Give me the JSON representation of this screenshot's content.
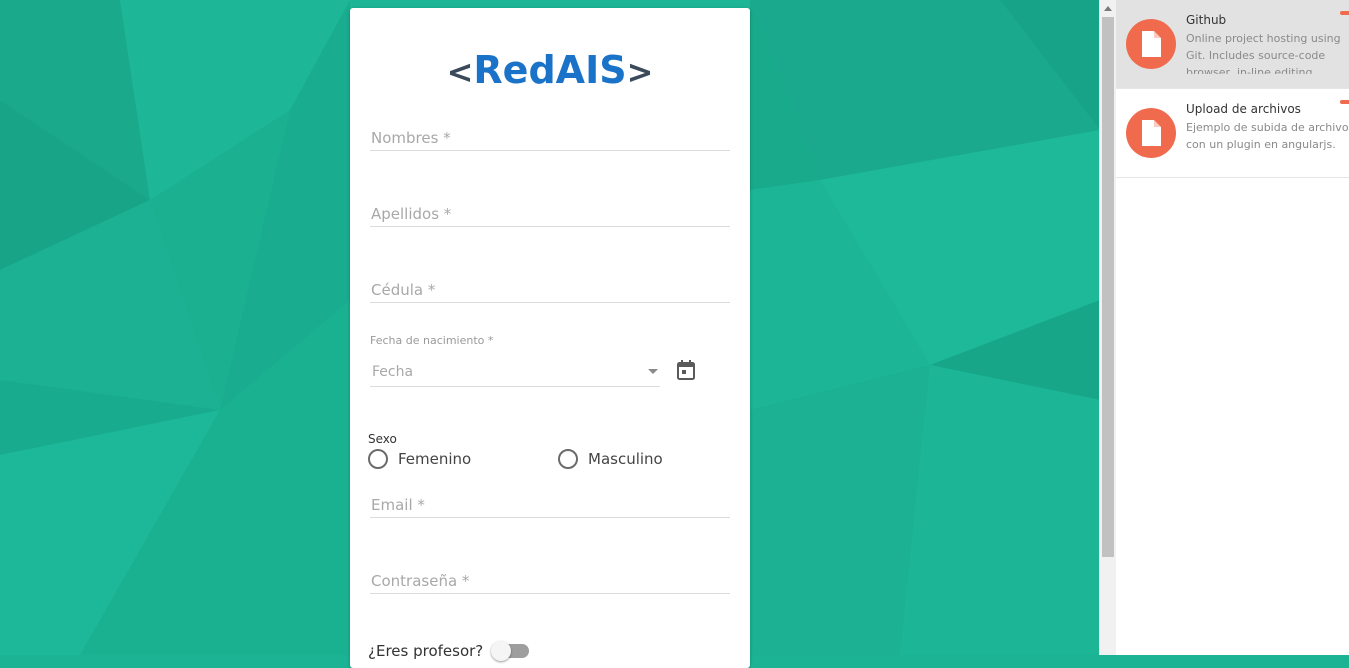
{
  "logo": {
    "open_bracket": "<",
    "text": "RedAIS",
    "close_bracket": ">"
  },
  "form": {
    "nombres_label": "Nombres *",
    "apellidos_label": "Apellidos *",
    "cedula_label": "Cédula *",
    "fecha_caption": "Fecha de nacimiento *",
    "fecha_placeholder": "Fecha",
    "calendar_icon": "calendar-icon",
    "sexo_label": "Sexo",
    "sexo_options": [
      "Femenino",
      "Masculino"
    ],
    "email_label": "Email *",
    "password_label": "Contraseña *",
    "profesor_label": "¿Eres profesor?"
  },
  "side_panel": {
    "items": [
      {
        "title": "Github",
        "description": "Online project hosting using Git. Includes source-code browser, in-line editing",
        "icon": "file-icon",
        "active": true
      },
      {
        "title": "Upload de archivos",
        "description": "Ejemplo de subida de archivos con un plugin en angularjs.",
        "icon": "file-icon",
        "active": false
      }
    ]
  },
  "colors": {
    "background": "#1bb394",
    "logo_blue": "#1a73c9",
    "avatar": "#f06a4e"
  }
}
